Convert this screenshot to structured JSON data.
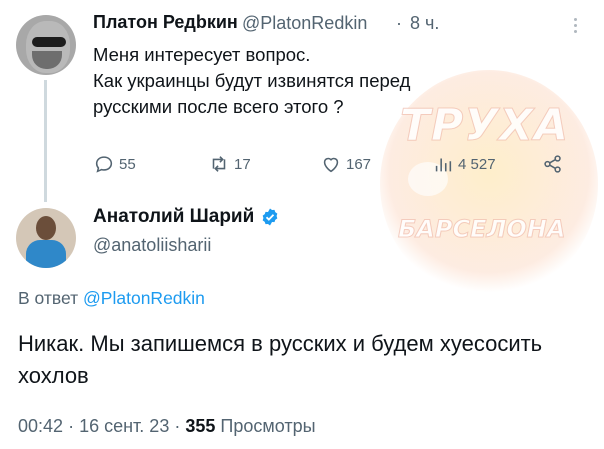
{
  "watermark": {
    "top": "ТРУХА",
    "bottom": "БАРСЕЛОНА"
  },
  "reply_parent": {
    "name": "Платон Редbкин",
    "handle": "@PlatonRedkin",
    "separator": "·",
    "time": "8 ч.",
    "text": "Меня интересует вопрос.\nКак украинцы будут извинятся перед\nрусскими после всего этого ?",
    "stats": {
      "replies": "55",
      "reposts": "17",
      "likes": "167",
      "views": "4 527"
    }
  },
  "main_tweet": {
    "name": "Анатолий Шарий",
    "handle": "@anatoliisharii",
    "reply_prefix": "В ответ",
    "reply_mention": "@PlatonRedkin",
    "text": "Никак. Мы запишемся в русских и будем хуесосить хохлов",
    "time": "00:42",
    "date": "16 сент. 23",
    "views_count": "355",
    "views_label": "Просмотры"
  },
  "colors": {
    "accent": "#1d9bf0",
    "muted": "#536471",
    "text": "#0f1419"
  },
  "icons": [
    "more-icon",
    "reply-icon",
    "repost-icon",
    "like-icon",
    "views-icon",
    "share-icon",
    "verified-badge-icon"
  ]
}
